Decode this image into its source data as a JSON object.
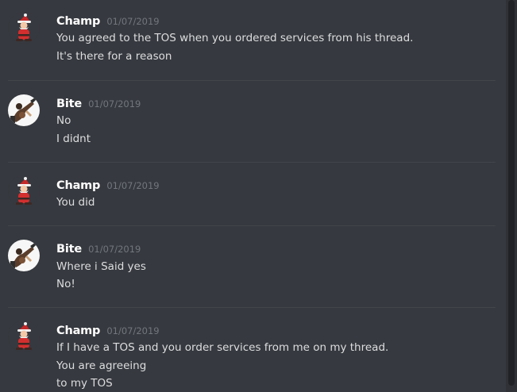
{
  "messages": [
    {
      "author": "Champ",
      "avatar_icon": "santa-icon",
      "timestamp": "01/07/2019",
      "lines": [
        "You agreed to the TOS when you ordered services from his thread.",
        "It's there for a reason"
      ]
    },
    {
      "author": "Bite",
      "avatar_icon": "guitarist-icon",
      "timestamp": "01/07/2019",
      "lines": [
        "No",
        "I didnt"
      ]
    },
    {
      "author": "Champ",
      "avatar_icon": "santa-icon",
      "timestamp": "01/07/2019",
      "lines": [
        "You did"
      ]
    },
    {
      "author": "Bite",
      "avatar_icon": "guitarist-icon",
      "timestamp": "01/07/2019",
      "lines": [
        "Where i Said yes",
        "No!"
      ]
    },
    {
      "author": "Champ",
      "avatar_icon": "santa-icon",
      "timestamp": "01/07/2019",
      "lines": [
        "If I have a TOS and you order services from me on my thread.",
        "You are agreeing",
        "to my TOS"
      ]
    }
  ],
  "colors": {
    "background": "#36393f",
    "username": "#ffffff",
    "message_text": "#dcddde",
    "timestamp": "#72767d",
    "divider": "#42454a",
    "scrollbar_track": "#2f3136",
    "scrollbar_thumb": "#202225"
  }
}
